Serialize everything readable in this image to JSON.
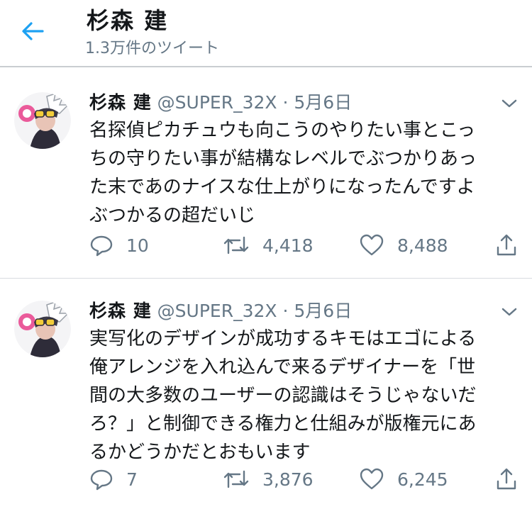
{
  "header": {
    "title": "杉森 建",
    "subtitle": "1.3万件のツイート",
    "back_icon": "arrow-left-icon",
    "accent": "#1da1f2"
  },
  "tweets": [
    {
      "name": "杉森 建",
      "handle": "@SUPER_32X",
      "dot": "·",
      "date": "5月6日",
      "text": "名探偵ピカチュウも向こうのやりたい事とこっ\nちの守りたい事が結構なレベルでぶつかりあっ\nた末であのナイスな仕上がりになったんですよ\nぶつかるの超だいじ",
      "replies": "10",
      "retweets": "4,418",
      "likes": "8,488"
    },
    {
      "name": "杉森 建",
      "handle": "@SUPER_32X",
      "dot": "·",
      "date": "5月6日",
      "text": "実写化のデザインが成功するキモはエゴによる\n俺アレンジを入れ込んで来るデザイナーを「世\n間の大多数のユーザーの認識はそうじゃないだ\nろ？」と制御できる権力と仕組みが版権元にあ\nるかどうかだとおもいます",
      "replies": "7",
      "retweets": "3,876",
      "likes": "6,245"
    }
  ]
}
